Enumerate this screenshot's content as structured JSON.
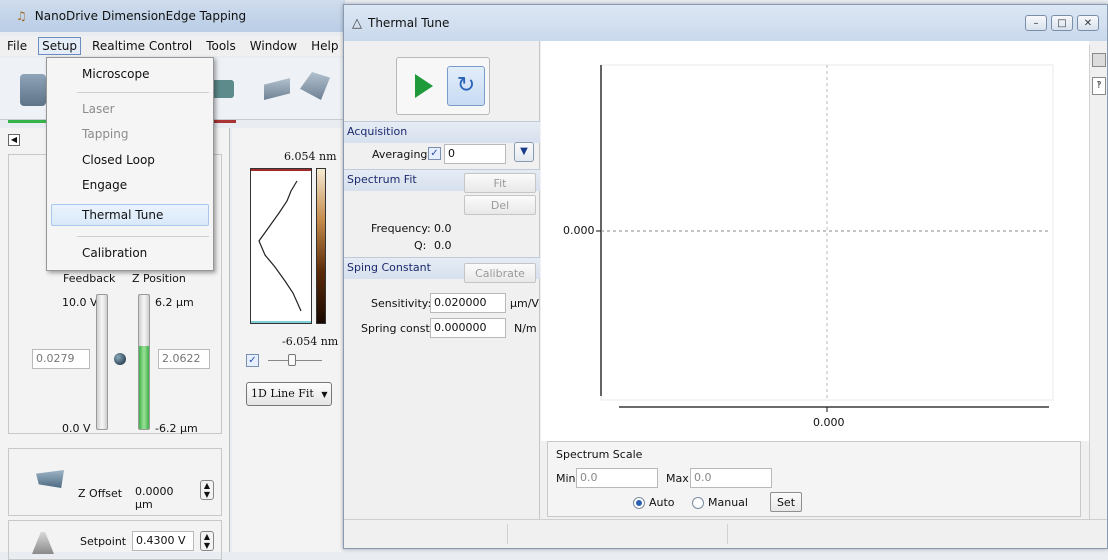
{
  "app": {
    "title": "NanoDrive DimensionEdge Tapping",
    "menu": [
      "File",
      "Setup",
      "Realtime Control",
      "Tools",
      "Window",
      "Help"
    ]
  },
  "setup_menu": {
    "items": [
      "Microscope",
      "Laser",
      "Tapping",
      "Closed Loop",
      "Engage",
      "Thermal Tune",
      "Calibration"
    ]
  },
  "left_panel": {
    "feedback_label": "Feedback",
    "zposition_label": "Z Position",
    "feedback_top": "10.0 V",
    "feedback_bottom": "0.0 V",
    "feedback_value": "0.0279",
    "z_top": "6.2 µm",
    "z_bottom": "-6.2 µm",
    "z_value": "2.0622",
    "z_offset_label": "Z Offset",
    "z_offset_value": "0.0000 µm",
    "setpoint_label": "Setpoint",
    "setpoint_value": "0.4300 V"
  },
  "mid_panel": {
    "scale_top": "6.054 nm",
    "scale_bottom": "-6.054 nm",
    "line_fit": "1D Line Fit"
  },
  "thermal_tune": {
    "title": "Thermal Tune",
    "acquisition_header": "Acquisition",
    "averaging_label": "Averaging",
    "averaging_value": "0",
    "spectrum_fit_header": "Spectrum Fit",
    "fit_button": "Fit",
    "del_button": "Del",
    "frequency_label": "Frequency:",
    "frequency_value": "0.0",
    "q_label": "Q:",
    "q_value": "0.0",
    "spring_header": "Sping Constant",
    "calibrate_button": "Calibrate",
    "sensitivity_label": "Sensitivity:",
    "sensitivity_value": "0.020000",
    "sensitivity_unit": "µm/V",
    "spring_const_label": "Spring const:",
    "spring_const_value": "0.000000",
    "spring_const_unit": "N/m",
    "plot_y_tick": "0.000",
    "plot_x_tick": "0.000",
    "spectrum_scale_label": "Spectrum Scale",
    "min_label": "Min",
    "min_value": "0.0",
    "max_label": "Max",
    "max_value": "0.0",
    "auto_label": "Auto",
    "manual_label": "Manual",
    "set_button": "Set"
  }
}
